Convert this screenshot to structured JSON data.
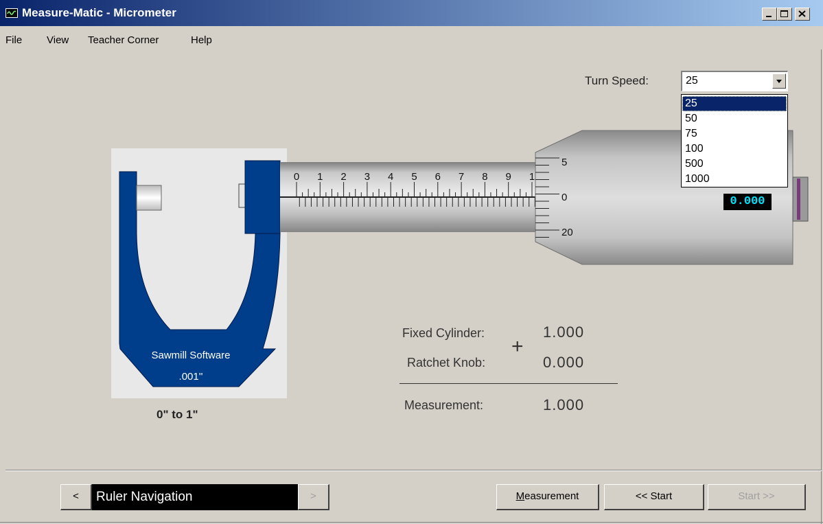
{
  "window": {
    "title": "Measure-Matic - Micrometer"
  },
  "menu": {
    "items": [
      "File",
      "View",
      "Teacher Corner",
      "Help"
    ]
  },
  "turn_speed": {
    "label": "Turn Speed:",
    "value": "25",
    "options": [
      "25",
      "50",
      "75",
      "100",
      "500",
      "1000"
    ],
    "selected_index": 0
  },
  "micrometer": {
    "brand": "Sawmill Software",
    "resolution": ".001''",
    "range": "0\" to 1\"",
    "sleeve_numbers": [
      "0",
      "1",
      "2",
      "3",
      "4",
      "5",
      "6",
      "7",
      "8",
      "9",
      "1"
    ],
    "thimble_numbers": [
      "5",
      "0",
      "20"
    ],
    "reading_display": "0.000"
  },
  "calculation": {
    "fixed_cylinder_label": "Fixed Cylinder:",
    "fixed_cylinder_value": "1.000",
    "ratchet_knob_label": "Ratchet Knob:",
    "ratchet_knob_value": "0.000",
    "plus": "+",
    "measurement_label": "Measurement:",
    "measurement_value": "1.000"
  },
  "navigation": {
    "prev_label": "<",
    "display_text": "Ruler Navigation",
    "next_label": ">",
    "measurement_button": "Measurement",
    "back_start_button": "<< Start",
    "forward_start_button": "Start >>"
  },
  "colors": {
    "frame_blue": "#003d8a",
    "titlebar_start": "#0a246a",
    "titlebar_end": "#a6caf0",
    "reading_text": "#00e5ff",
    "window_face": "#d4d0c8"
  }
}
